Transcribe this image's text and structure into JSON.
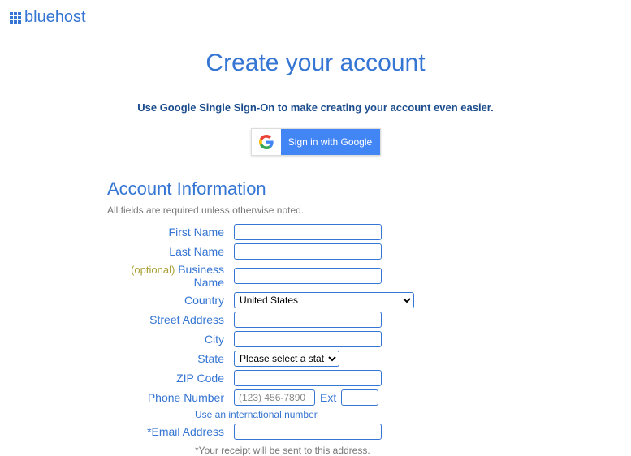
{
  "logo": {
    "text": "bluehost"
  },
  "title": "Create your account",
  "sso_note": "Use Google Single Sign-On to make creating your account even easier.",
  "google_button": "Sign in with Google",
  "section_title": "Account Information",
  "required_note": "All fields are required unless otherwise noted.",
  "labels": {
    "first_name": "First Name",
    "last_name": "Last Name",
    "optional": "(optional)",
    "business_name": "Business Name",
    "country": "Country",
    "street_address": "Street Address",
    "city": "City",
    "state": "State",
    "zip_code": "ZIP Code",
    "phone_number": "Phone Number",
    "ext": "Ext",
    "email_address": "*Email Address"
  },
  "fields": {
    "country_selected": "United States",
    "state_placeholder": "Please select a state",
    "phone_placeholder": "(123) 456-7890"
  },
  "intl_link": "Use an international number",
  "receipt_note": "*Your receipt will be sent to this address."
}
